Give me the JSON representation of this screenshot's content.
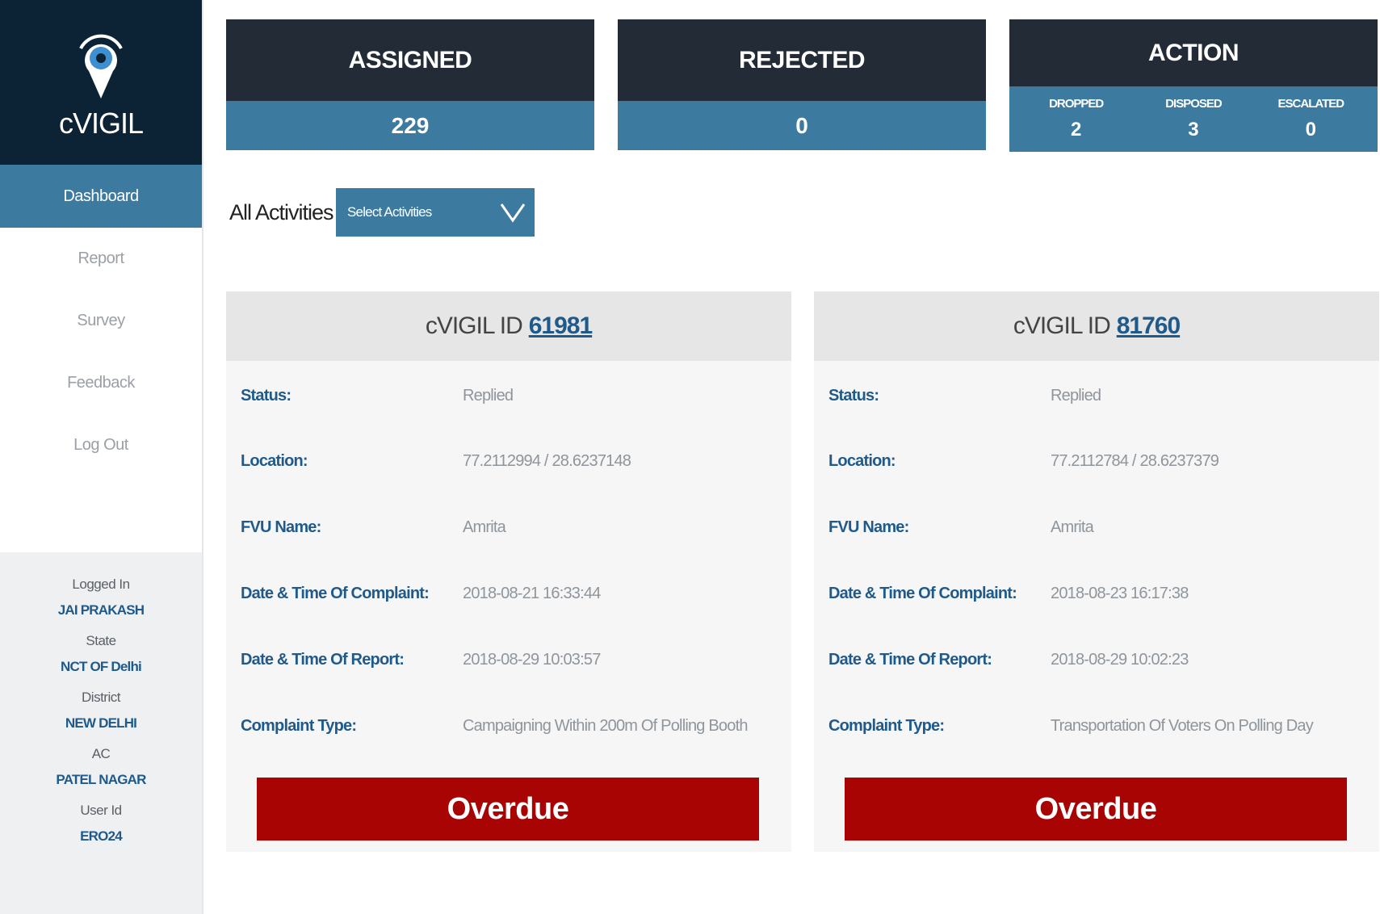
{
  "app": {
    "name": "cVIGIL"
  },
  "sidebar": {
    "items": [
      {
        "label": "Dashboard",
        "active": true
      },
      {
        "label": "Report"
      },
      {
        "label": "Survey"
      },
      {
        "label": "Feedback"
      },
      {
        "label": "Log Out"
      }
    ],
    "user_info": [
      {
        "label": "Logged In",
        "value": "JAI PRAKASH"
      },
      {
        "label": "State",
        "value": "NCT OF Delhi"
      },
      {
        "label": "District",
        "value": "NEW DELHI"
      },
      {
        "label": "AC",
        "value": "PATEL NAGAR"
      },
      {
        "label": "User Id",
        "value": "ERO24"
      }
    ]
  },
  "stats": {
    "assigned": {
      "label": "ASSIGNED",
      "value": "229"
    },
    "rejected": {
      "label": "REJECTED",
      "value": "0"
    },
    "action": {
      "label": "ACTION",
      "items": [
        {
          "label": "DROPPED",
          "value": "2"
        },
        {
          "label": "DISPOSED",
          "value": "3"
        },
        {
          "label": "ESCALATED",
          "value": "0"
        }
      ]
    }
  },
  "filter": {
    "label": "All Activities",
    "select_text": "Select Activities"
  },
  "field_labels": {
    "status": "Status:",
    "location": "Location:",
    "fvu_name": "FVU Name:",
    "complaint_time": "Date & Time Of Complaint:",
    "report_time": "Date & Time Of Report:",
    "complaint_type": "Complaint Type:"
  },
  "cards": [
    {
      "id_prefix": "cVIGIL ID",
      "id": "61981",
      "status": "Replied",
      "location": "77.2112994 / 28.6237148",
      "fvu_name": "Amrita",
      "complaint_time": "2018-08-21 16:33:44",
      "report_time": "2018-08-29 10:03:57",
      "complaint_type": "Campaigning Within 200m Of Polling Booth",
      "badge": "Overdue"
    },
    {
      "id_prefix": "cVIGIL ID",
      "id": "81760",
      "status": "Replied",
      "location": "77.2112784 / 28.6237379",
      "fvu_name": "Amrita",
      "complaint_time": "2018-08-23 16:17:38",
      "report_time": "2018-08-29 10:02:23",
      "complaint_type": "Transportation Of Voters On Polling Day",
      "badge": "Overdue"
    }
  ],
  "colors": {
    "navy": "#0c2336",
    "dark_header": "#222b36",
    "accent_blue": "#3d7aa0",
    "link_blue": "#1f5a8a",
    "overdue_red": "#a80404"
  }
}
